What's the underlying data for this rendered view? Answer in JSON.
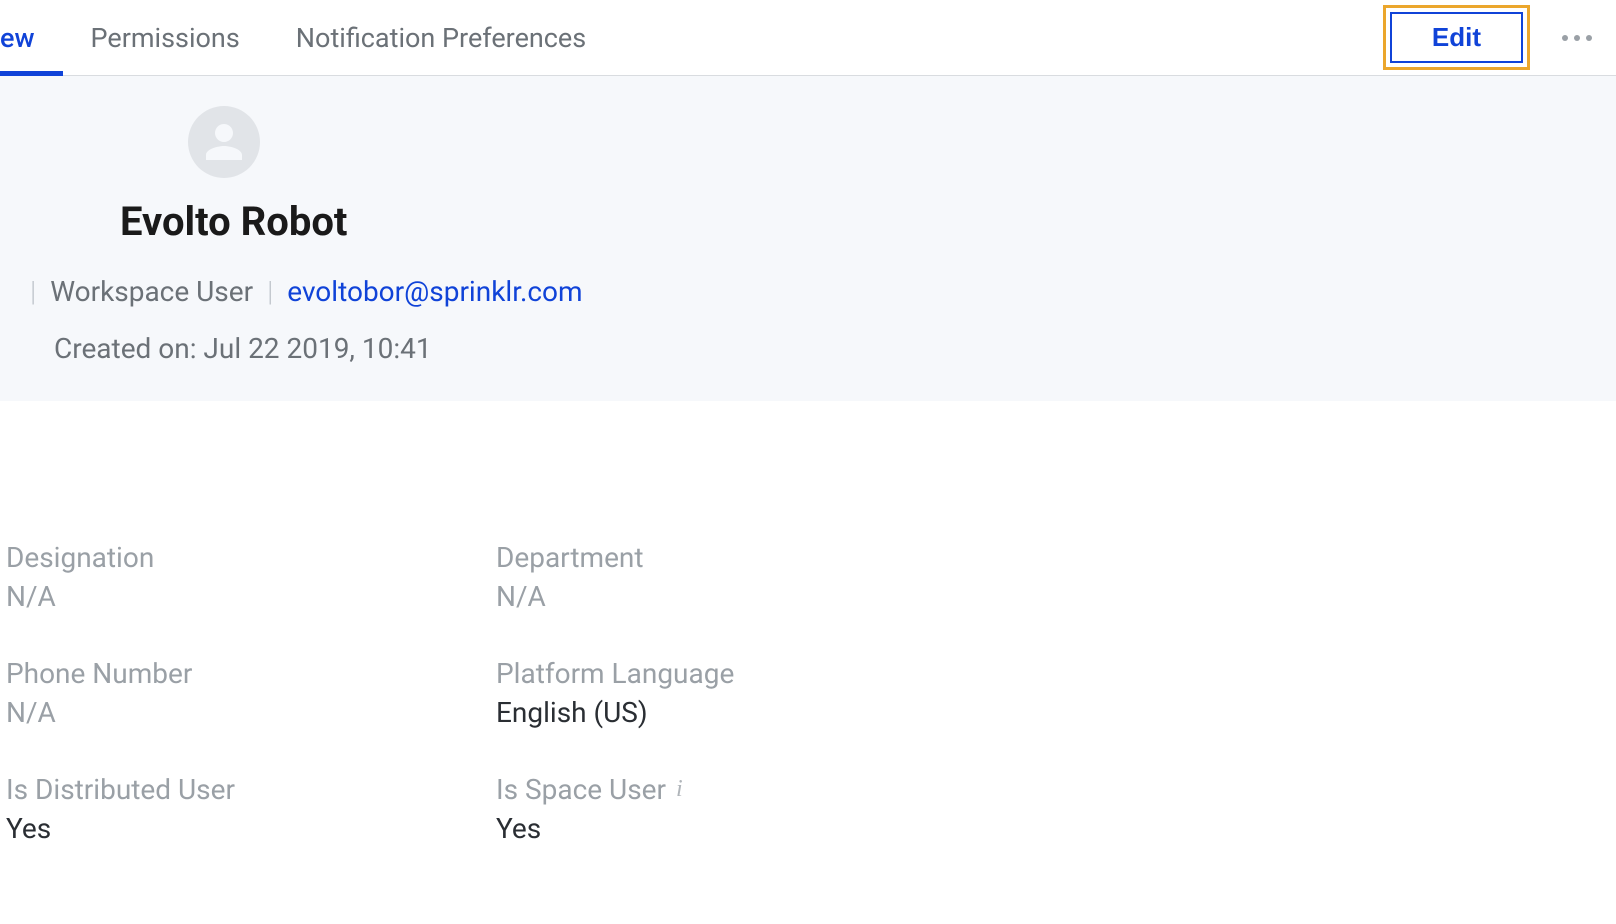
{
  "tabs": {
    "overview": "ew",
    "permissions": "Permissions",
    "notifications": "Notification Preferences"
  },
  "header": {
    "edit_label": "Edit"
  },
  "profile": {
    "name": "Evolto Robot",
    "role": "Workspace User",
    "email": "evoltobor@sprinklr.com",
    "created_label": "Created on: Jul 22 2019, 10:41"
  },
  "details": {
    "designation": {
      "label": "Designation",
      "value": "N/A"
    },
    "department": {
      "label": "Department",
      "value": "N/A"
    },
    "phone": {
      "label": "Phone Number",
      "value": "N/A"
    },
    "language": {
      "label": "Platform Language",
      "value": "English (US)"
    },
    "distributed": {
      "label": "Is Distributed User",
      "value": "Yes"
    },
    "space": {
      "label": "Is Space User",
      "value": "Yes"
    }
  }
}
